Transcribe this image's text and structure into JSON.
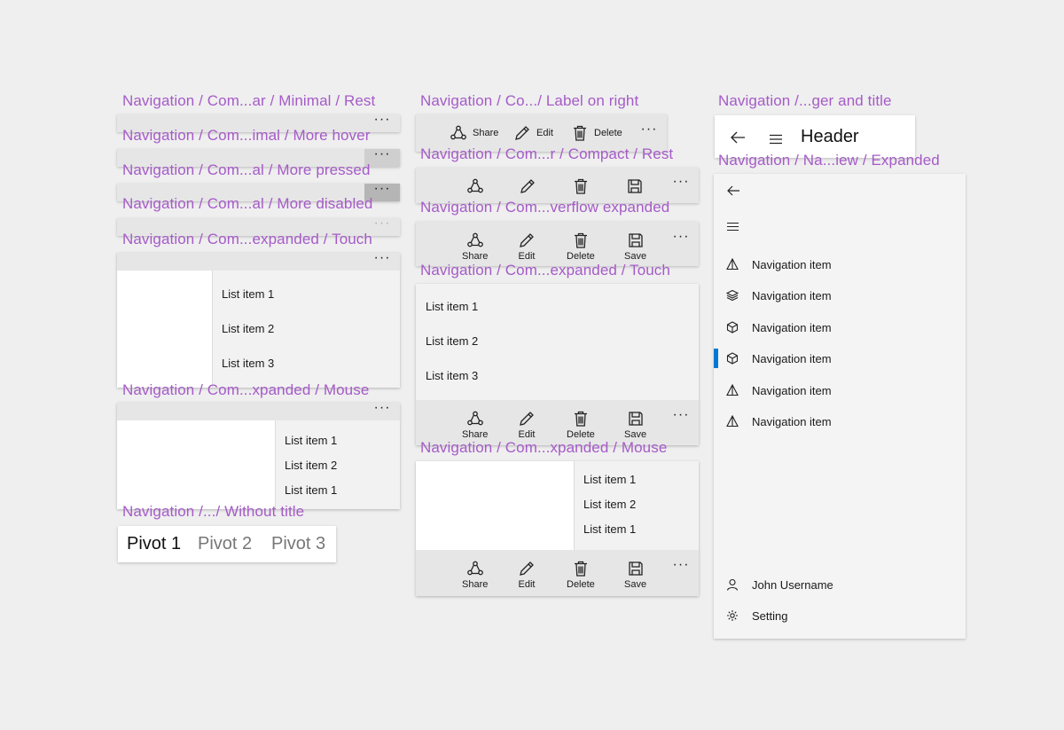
{
  "captions": {
    "c1": "Navigation / Com...ar / Minimal / Rest",
    "c2": "Navigation / Com...imal / More hover",
    "c3": "Navigation / Com...al / More pressed",
    "c4": "Navigation / Com...al / More disabled",
    "c5": "Navigation / Com...expanded / Touch",
    "c6": "Navigation / Com...xpanded / Mouse",
    "c7": "Navigation /.../ Without title",
    "c8": "Navigation / Co.../ Label on right",
    "c9": "Navigation / Com...r / Compact / Rest",
    "c10": "Navigation / Com...verflow expanded",
    "c11": "Navigation / Com...expanded / Touch",
    "c12": "Navigation / Com...xpanded / Mouse",
    "c13": "Navigation /...ger and title",
    "c14": "Navigation / Na...iew / Expanded"
  },
  "more_glyph": "···",
  "touch_menu": [
    "List item 1",
    "List item 2",
    "List item 3"
  ],
  "mouse_menu": [
    "List item 1",
    "List item 2",
    "List item 1"
  ],
  "commands": {
    "share": "Share",
    "edit": "Edit",
    "delete": "Delete",
    "save": "Save"
  },
  "pivot": [
    "Pivot 1",
    "Pivot 2",
    "Pivot 3"
  ],
  "header": {
    "title": "Header"
  },
  "nav_view": {
    "items": [
      {
        "label": "Navigation item",
        "icon": "triangle-icon"
      },
      {
        "label": "Navigation item",
        "icon": "layers-icon"
      },
      {
        "label": "Navigation item",
        "icon": "cube-icon"
      },
      {
        "label": "Navigation item",
        "icon": "cube-icon"
      },
      {
        "label": "Navigation item",
        "icon": "triangle-icon"
      },
      {
        "label": "Navigation item",
        "icon": "triangle-icon"
      }
    ],
    "selected_index": 3,
    "account": "John Username",
    "setting": "Setting"
  },
  "colors": {
    "caption": "#a55bc8",
    "accent": "#0078d4"
  }
}
